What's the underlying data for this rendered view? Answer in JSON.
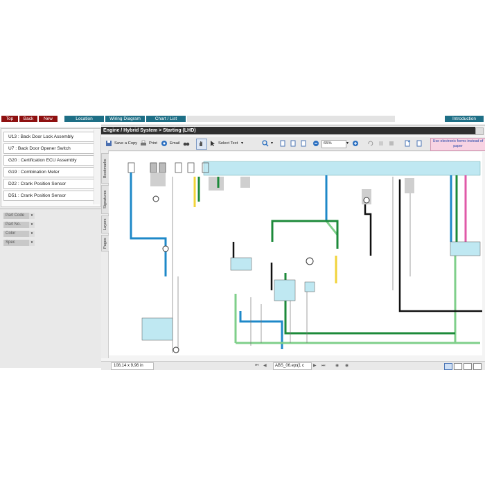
{
  "nav": {
    "top": "Top",
    "back": "Back",
    "new": "New"
  },
  "tabs": {
    "location": "Location",
    "wiring": "Wiring Diagram",
    "chart": "Chart / List",
    "intro": "Introduction"
  },
  "components": [
    "U13 : Back Door Lock Assembly",
    "U7 : Back Door Opener Switch",
    "G20 : Certification ECU Assembly",
    "G19 : Combination Meter",
    "D22 : Crank Position Sensor",
    "D51 : Crank Position Sensor"
  ],
  "spec_fields": [
    "Part Code",
    "Part No.",
    "Color",
    "Spec"
  ],
  "viewer": {
    "title": "Engine / Hybrid System > Starting (LHD)",
    "save_copy": "Save a Copy",
    "print": "Print",
    "email": "Email",
    "select_text": "Select Text",
    "zoom": "65%",
    "electronic_forms": "Use electronic forms instead of paper",
    "side_tabs": [
      "Bookmarks",
      "Signatures",
      "Layers",
      "Pages"
    ],
    "dimensions": "108,14 x 9,96 in",
    "page_label": "ABS_06.eps",
    "page_count": "(1 c"
  },
  "colors": {
    "nav_red": "#8e1010",
    "tab_teal": "#1e6f86",
    "wire_blue": "#1e88c8",
    "wire_green": "#1c8a3a",
    "wire_light_green": "#7fcf8a",
    "wire_yellow": "#f1d33a",
    "wire_pink": "#e05aa8",
    "wire_black": "#111111",
    "connector_bar": "#bfe8f2"
  }
}
